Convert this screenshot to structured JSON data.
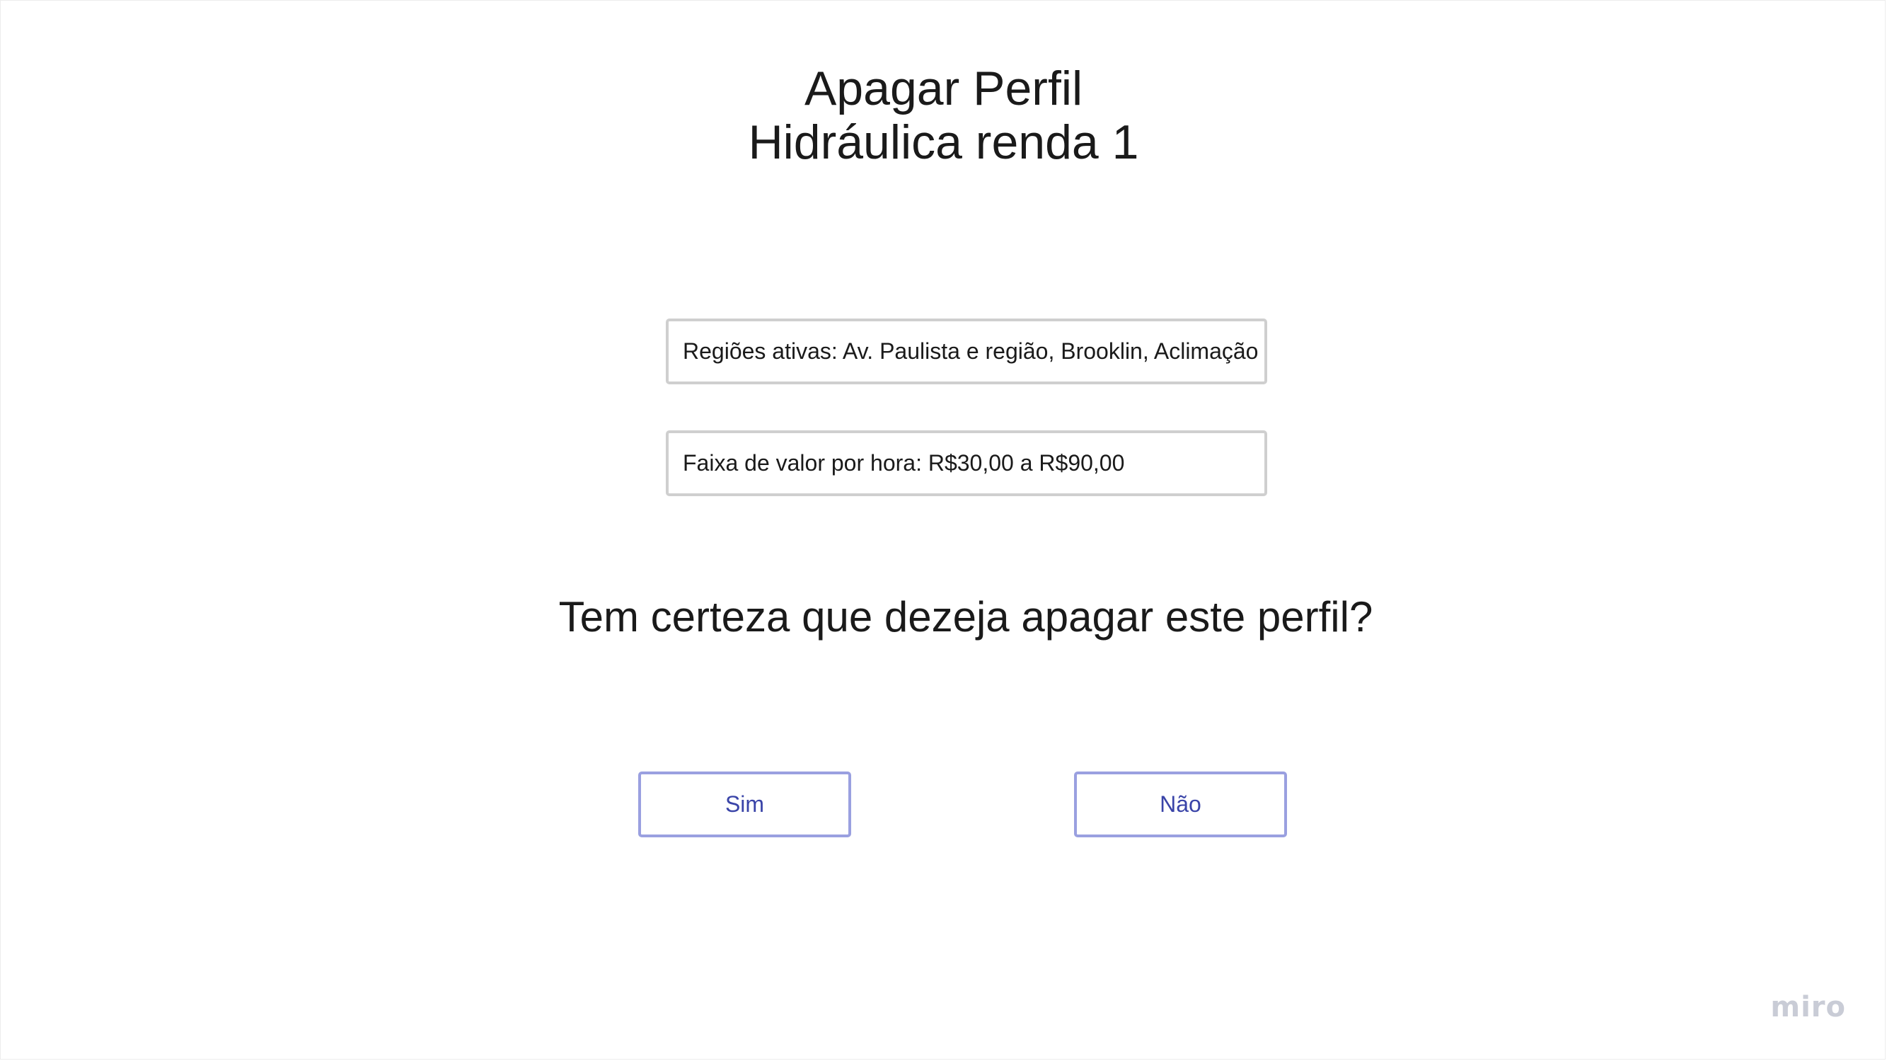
{
  "header": {
    "title_line1": "Apagar Perfil",
    "title_line2": "Hidráulica renda 1"
  },
  "profile": {
    "regions_text": "Regiões ativas: Av. Paulista e região, Brooklin, Aclimação",
    "price_range_text": "Faixa de valor por hora: R$30,00 a R$90,00"
  },
  "dialog": {
    "question": "Tem certeza que dezeja apagar este perfil?",
    "yes_label": "Sim",
    "no_label": "Não"
  },
  "branding": {
    "logo_text": "miro"
  },
  "colors": {
    "button_border": "#9aa0e0",
    "button_text": "#3a44a8",
    "box_border": "#cfcfcf"
  }
}
